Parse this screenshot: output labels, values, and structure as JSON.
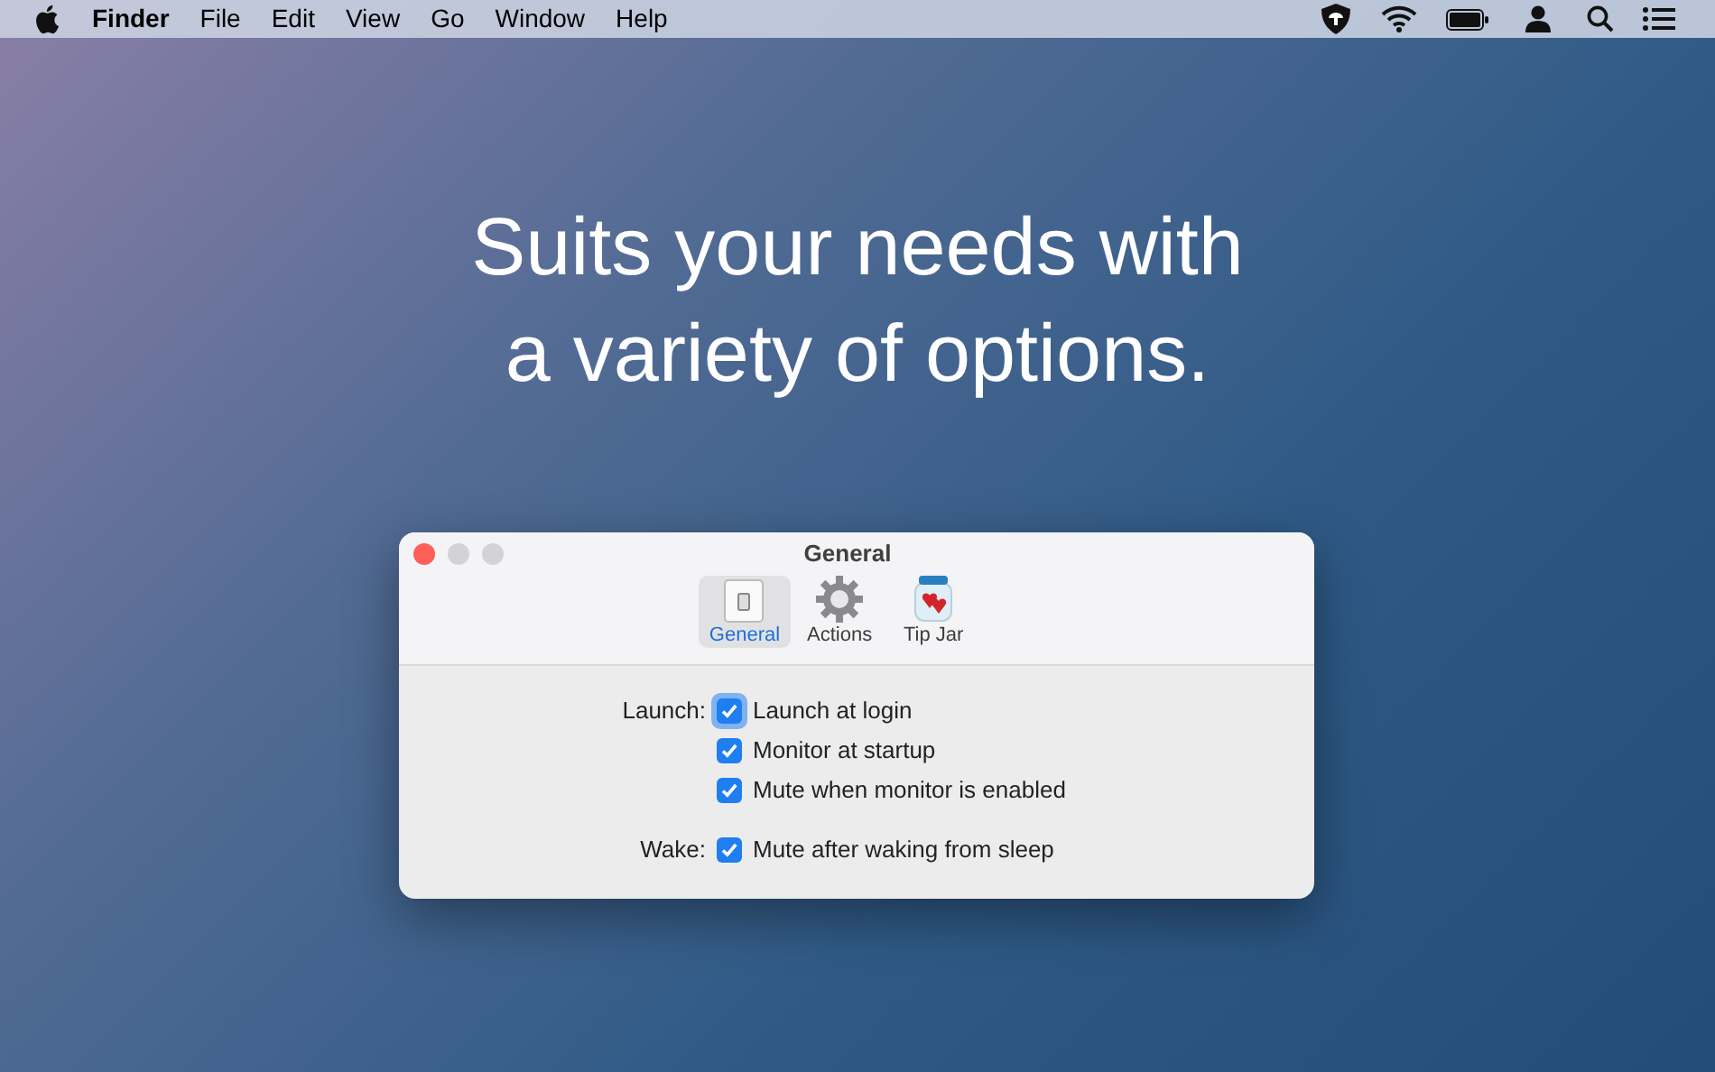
{
  "menu_bar": {
    "app": "Finder",
    "menus": [
      "File",
      "Edit",
      "View",
      "Go",
      "Window",
      "Help"
    ]
  },
  "headline": "Suits your needs with a variety of options.",
  "window": {
    "title": "General",
    "tabs": [
      {
        "label": "General",
        "kind": "switch",
        "selected": true
      },
      {
        "label": "Actions",
        "kind": "gear",
        "selected": false
      },
      {
        "label": "Tip Jar",
        "kind": "jar",
        "selected": false
      }
    ],
    "groups": [
      {
        "label": "Launch:",
        "options": [
          {
            "label": "Launch at login",
            "checked": true,
            "focused": true
          },
          {
            "label": "Monitor at startup",
            "checked": true,
            "focused": false
          },
          {
            "label": "Mute when monitor is enabled",
            "checked": true,
            "focused": false
          }
        ]
      },
      {
        "label": "Wake:",
        "options": [
          {
            "label": "Mute after waking from sleep",
            "checked": true,
            "focused": false
          }
        ]
      }
    ]
  }
}
